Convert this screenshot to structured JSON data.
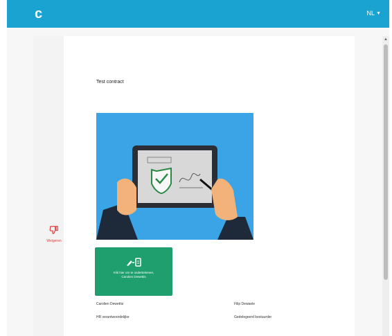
{
  "header": {
    "brand": "c",
    "language": "NL"
  },
  "document": {
    "title": "Test contract"
  },
  "sign_button": {
    "line1": "Klik hier om te ondertekenen,",
    "line2": "Carolien Dewettis"
  },
  "refuse": {
    "label": "Weigeren"
  },
  "signatories": [
    {
      "name": "Carolien Dewettis",
      "role": "HR verantwoordelijke"
    },
    {
      "name": "Filip Dewaele",
      "role": "Gedelegeerd bestuurder"
    }
  ],
  "colors": {
    "brand_blue": "#1aa3d1",
    "sign_green": "#1f9e6e",
    "refuse_red": "#e13a3a"
  }
}
